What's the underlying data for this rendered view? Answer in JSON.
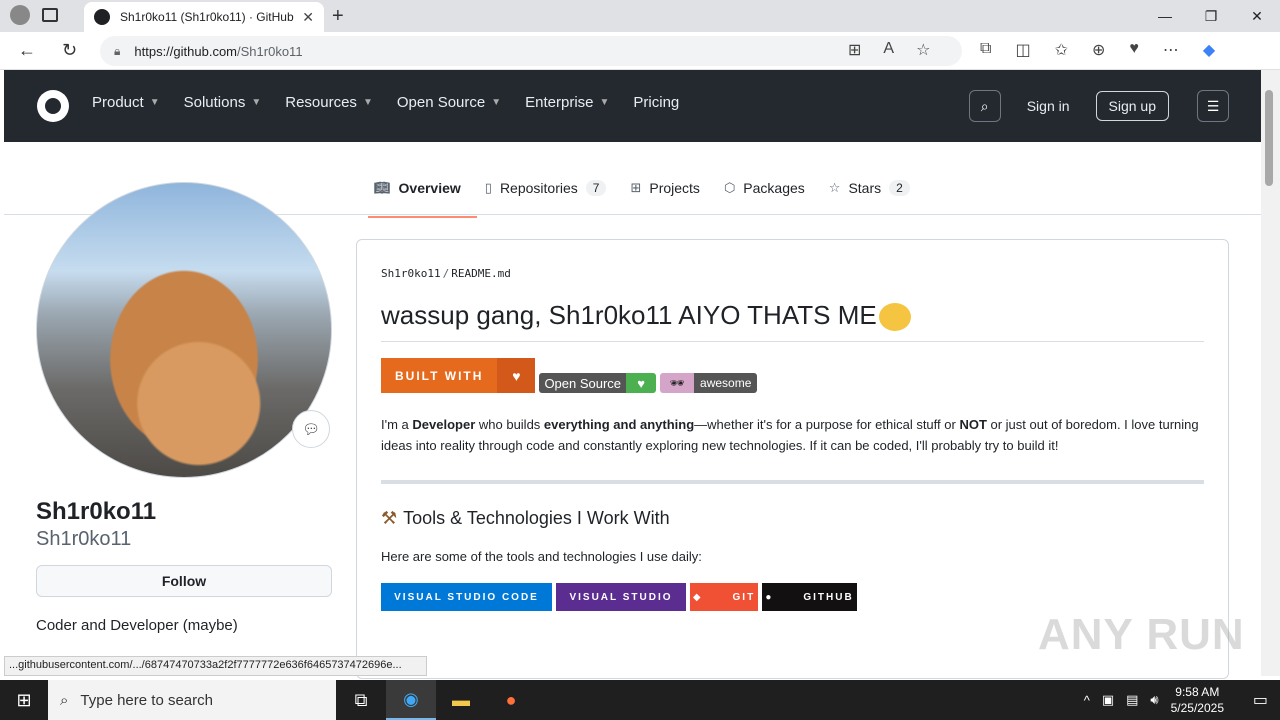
{
  "browser": {
    "tab_title": "Sh1r0ko11 (Sh1r0ko11) · GitHub",
    "url_host": "https://github.com",
    "url_path": "/Sh1r0ko11",
    "status_url": "...githubusercontent.com/.../68747470733a2f2f7777772e636f6465737472696e..."
  },
  "gh_nav": {
    "items": [
      "Product",
      "Solutions",
      "Resources",
      "Open Source",
      "Enterprise"
    ],
    "pricing": "Pricing",
    "sign_in": "Sign in",
    "sign_up": "Sign up"
  },
  "profile_tabs": {
    "overview": "Overview",
    "repositories": "Repositories",
    "repositories_count": "7",
    "projects": "Projects",
    "packages": "Packages",
    "stars": "Stars",
    "stars_count": "2"
  },
  "profile": {
    "name": "Sh1r0ko11",
    "login": "Sh1r0ko11",
    "follow": "Follow",
    "bio": "Coder and Developer (maybe)"
  },
  "readme": {
    "crumb_user": "Sh1r0ko11",
    "crumb_file": "README.md",
    "title": "wassup gang, Sh1r0ko11 AIYO THATS ME",
    "badge_built": "BUILT WITH",
    "badge_os": "Open Source",
    "badge_awesome": "awesome",
    "para_1": "I'm a ",
    "para_developer": "Developer",
    "para_2": " who builds ",
    "para_everything": "everything and anything",
    "para_3": "—whether it's for a purpose for ethical stuff or ",
    "para_not": "NOT",
    "para_4": " or just out of boredom. I love turning ideas into reality through code and constantly exploring new technologies. If it can be coded, I'll probably try to build it!",
    "tools_heading": "Tools & Technologies I Work With",
    "tools_sub": "Here are some of the tools and technologies I use daily:",
    "tech": [
      "VISUAL STUDIO CODE",
      "VISUAL STUDIO",
      "GIT",
      "GITHUB"
    ]
  },
  "watermark": "ANY RUN",
  "taskbar": {
    "search_placeholder": "Type here to search",
    "time": "9:58 AM",
    "date": "5/25/2025"
  },
  "colors": {
    "gh_header": "#24292f",
    "tab_underline": "#fd8c73",
    "built_with": "#e66a1e",
    "vscode": "#0078d7",
    "visual_studio": "#5c2d91",
    "git": "#f05033",
    "github": "#121011"
  }
}
